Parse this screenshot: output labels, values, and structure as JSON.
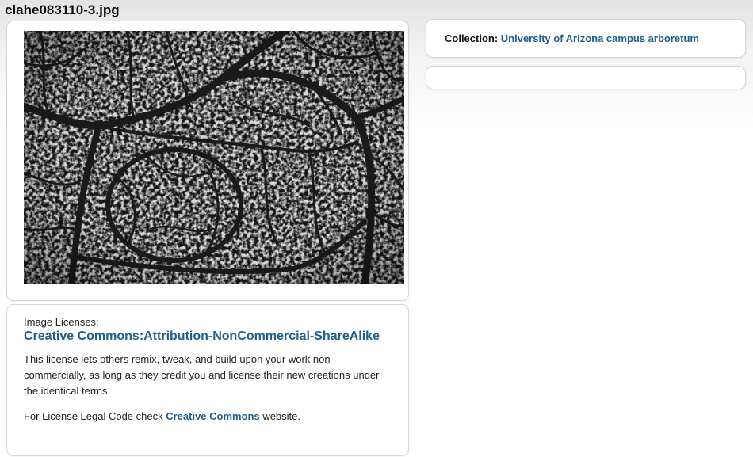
{
  "page": {
    "title": "clahe083110-3.jpg"
  },
  "image": {
    "alt": "Leaf venation micrograph",
    "icon": "photo"
  },
  "license": {
    "caption": "Image Licenses:",
    "name": "Creative Commons:Attribution-NonCommercial-ShareAlike",
    "description": "This license lets others remix, tweak, and build upon your work non-commercially, as long as they credit you and license their new creations under the identical terms.",
    "legal_prefix": "For License Legal Code check ",
    "legal_link": "Creative Commons",
    "legal_suffix": " website."
  },
  "collection": {
    "label": "Collection:",
    "value": "University of Arizona campus arboretum"
  },
  "colors": {
    "link": "#1f5f8b",
    "panel_border": "#d6d6d6",
    "background_top": "#e3e3e3"
  }
}
